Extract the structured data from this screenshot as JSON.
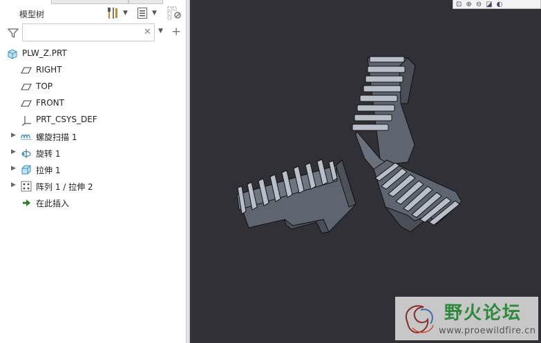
{
  "model_tree": {
    "title": "模型树",
    "filter": {
      "placeholder": "",
      "value": ""
    },
    "items": [
      {
        "label": "PLW_Z.PRT",
        "icon": "part-icon"
      },
      {
        "label": "RIGHT",
        "icon": "datum-plane-icon"
      },
      {
        "label": "TOP",
        "icon": "datum-plane-icon"
      },
      {
        "label": "FRONT",
        "icon": "datum-plane-icon"
      },
      {
        "label": "PRT_CSYS_DEF",
        "icon": "csys-icon"
      },
      {
        "label": "螺旋扫描 1",
        "icon": "helical-sweep-icon"
      },
      {
        "label": "旋转 1",
        "icon": "revolve-icon"
      },
      {
        "label": "拉伸 1",
        "icon": "extrude-icon"
      },
      {
        "label": "阵列 1 / 拉伸 2",
        "icon": "pattern-icon"
      },
      {
        "label": "在此插入",
        "icon": "insert-here-icon"
      }
    ]
  },
  "watermark": {
    "title": "野火论坛",
    "url": "www.proewildfire.cn"
  },
  "colors": {
    "viewport_bg": "#303036",
    "part_fill": "#6d7480",
    "insert_arrow": "#2a7d2a",
    "watermark_green": "#2e8a3a"
  }
}
